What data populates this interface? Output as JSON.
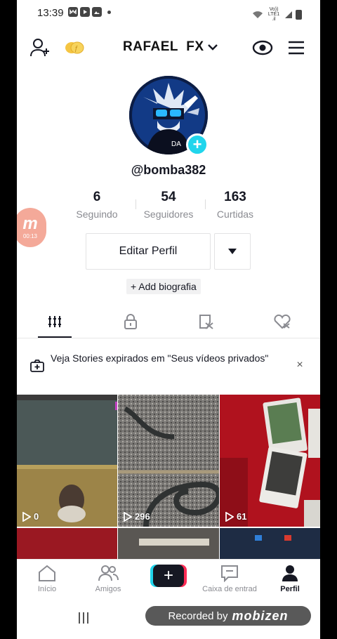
{
  "status_bar": {
    "time": "13:39",
    "network_label": "Vo)) LTE1 .il"
  },
  "header": {
    "display_name": "RAFAEL  FX",
    "icons": [
      "add-user-icon",
      "coins-icon",
      "chevron-down-icon",
      "eye-icon",
      "hamburger-menu-icon"
    ]
  },
  "profile": {
    "handle": "@bomba382",
    "avatar_add_label": "+"
  },
  "stats": [
    {
      "value": "6",
      "label": "Seguindo"
    },
    {
      "value": "54",
      "label": "Seguidores"
    },
    {
      "value": "163",
      "label": "Curtidas"
    }
  ],
  "mobizen_float": {
    "logo": "m",
    "timer": "00:13"
  },
  "actions": {
    "edit_profile": "Editar Perfil",
    "add_bio": "+ Add biografia"
  },
  "tabs": [
    "videos-grid-icon",
    "lock-icon",
    "hidden-likes-icon",
    "liked-heart-icon"
  ],
  "banner": {
    "text": "Veja Stories expirados em \"Seus vídeos privados\"",
    "close": "×"
  },
  "videos": [
    {
      "views": "0"
    },
    {
      "views": "296"
    },
    {
      "views": "61"
    }
  ],
  "bottom_nav": [
    {
      "label": "Início",
      "icon": "home-icon"
    },
    {
      "label": "Amigos",
      "icon": "friends-icon"
    },
    {
      "label": "+",
      "icon": "create-plus-icon"
    },
    {
      "label": "Caixa de entrad",
      "icon": "inbox-icon"
    },
    {
      "label": "Perfil",
      "icon": "profile-icon",
      "active": true
    }
  ],
  "recorder": {
    "prefix": "Recorded by",
    "brand": "mobizen"
  },
  "colors": {
    "cyan": "#20d5ec",
    "red": "#fe2c55",
    "text": "#161823",
    "muted": "#8a8b91"
  }
}
